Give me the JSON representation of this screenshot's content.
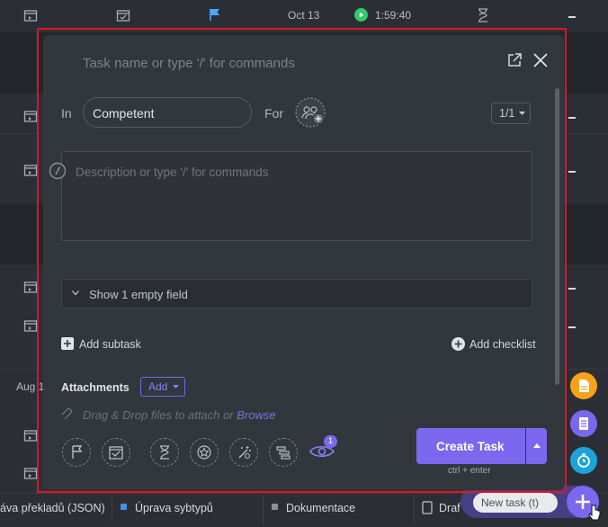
{
  "background": {
    "top_row": {
      "date": "Oct 13",
      "timer": "1:59:40"
    },
    "left_label": "Aug 1",
    "bottom_tabs": [
      {
        "label": "áva překladů (JSON)"
      },
      {
        "label": "Úprava sybtypů"
      },
      {
        "label": "Dokumentace"
      },
      {
        "label": "Draf"
      }
    ],
    "tooltip": "New task (t)"
  },
  "modal": {
    "task_name_placeholder": "Task name or type '/' for commands",
    "in_label": "In",
    "list_value": "Competent",
    "for_label": "For",
    "ratio": "1/1",
    "description_placeholder": "Description or type '/' for commands",
    "empty_field_label": "Show 1 empty field",
    "add_subtask_label": "Add subtask",
    "add_checklist_label": "Add checklist",
    "attachments_label": "Attachments",
    "add_button_label": "Add",
    "drop_text": "Drag & Drop files to attach or ",
    "browse_link": "Browse",
    "watchers_count": "1",
    "create_button_label": "Create Task",
    "shortcut_hint": "ctrl + enter"
  },
  "colors": {
    "accent": "#7b68ee",
    "frame": "#e0141e",
    "fab_orange": "#f7a21b",
    "fab_purple": "#7b68ee",
    "fab_teal": "#1ca3d8"
  },
  "icons": [
    "calendar-icon",
    "flag-icon",
    "play-icon",
    "hourglass-icon",
    "expand-icon",
    "close-icon",
    "team-icon",
    "tag-icon",
    "description-icon",
    "chevron-right-icon",
    "plus-icon",
    "paperclip-icon",
    "star-icon",
    "magic-icon",
    "gantt-icon",
    "eye-icon",
    "doc-icon",
    "note-icon",
    "timer-icon",
    "cursor-icon"
  ]
}
